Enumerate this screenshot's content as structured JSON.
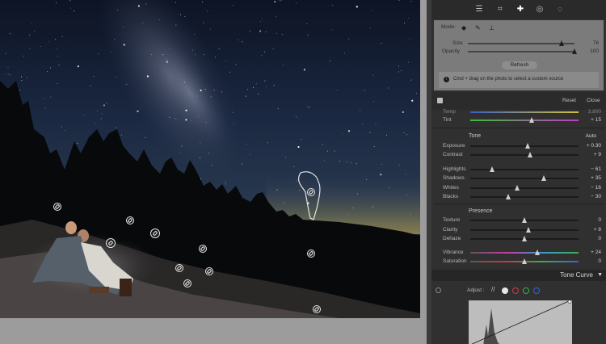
{
  "photo": {
    "healing_pins": [
      {
        "label": "spot-pin"
      },
      {
        "label": "spot-pin"
      },
      {
        "label": "spot-pin"
      },
      {
        "label": "spot-pin"
      },
      {
        "label": "spot-pin"
      },
      {
        "label": "spot-pin"
      },
      {
        "label": "spot-pin"
      },
      {
        "label": "spot-pin"
      },
      {
        "label": "spot-pin"
      },
      {
        "label": "spot-pin"
      },
      {
        "label": "spot-pin"
      }
    ]
  },
  "toolbar": {
    "icons": [
      "sliders-icon",
      "crop-icon",
      "bandage-icon",
      "red-eye-icon",
      "mask-circle-icon"
    ]
  },
  "heal": {
    "mode_label": "Mode:",
    "mode_icons": [
      "clone-icon",
      "heal-icon",
      "content-aware-icon"
    ],
    "size_label": "Size",
    "size_value": "76",
    "size_pct": 0.88,
    "opacity_label": "Opacity",
    "opacity_value": "100",
    "opacity_pct": 1.0,
    "refresh_label": "Refresh",
    "tip_text": "Cmd + drag on the photo to select a custom source",
    "reset_label": "Reset",
    "close_label": "Close"
  },
  "basic": {
    "temp_label": "Temp",
    "temp_value": "3,800",
    "tint_label": "Tint",
    "tint_value": "+ 15",
    "tone_title": "Tone",
    "auto_label": "Auto",
    "presence_title": "Presence",
    "sliders": [
      {
        "key": "exposure",
        "label": "Exposure",
        "value": "+ 0.30",
        "pct": 0.53
      },
      {
        "key": "contrast",
        "label": "Contrast",
        "value": "+ 9",
        "pct": 0.55
      },
      {
        "key": "highlights",
        "label": "Highlights",
        "value": "− 61",
        "pct": 0.2
      },
      {
        "key": "shadows",
        "label": "Shadows",
        "value": "+ 35",
        "pct": 0.68
      },
      {
        "key": "whites",
        "label": "Whites",
        "value": "− 16",
        "pct": 0.43
      },
      {
        "key": "blacks",
        "label": "Blacks",
        "value": "− 30",
        "pct": 0.35
      },
      {
        "key": "texture",
        "label": "Texture",
        "value": "0",
        "pct": 0.5
      },
      {
        "key": "clarity",
        "label": "Clarity",
        "value": "+ 8",
        "pct": 0.54
      },
      {
        "key": "dehaze",
        "label": "Dehaze",
        "value": "0",
        "pct": 0.5
      },
      {
        "key": "vibrance",
        "label": "Vibrance",
        "value": "+ 24",
        "pct": 0.62
      },
      {
        "key": "saturation",
        "label": "Saturation",
        "value": "0",
        "pct": 0.5
      }
    ]
  },
  "tone_curve": {
    "title": "Tone Curve",
    "adjust_label": "Adjust :",
    "channels": [
      "parametric-icon",
      "point-white",
      "point-red",
      "point-green",
      "point-blue"
    ]
  },
  "colors": {
    "panel_bg": "#303030",
    "heal_box_bg": "#7b7b7b",
    "red_channel": "#d23a3a",
    "green_channel": "#3aae4a",
    "blue_channel": "#3a63d2"
  }
}
